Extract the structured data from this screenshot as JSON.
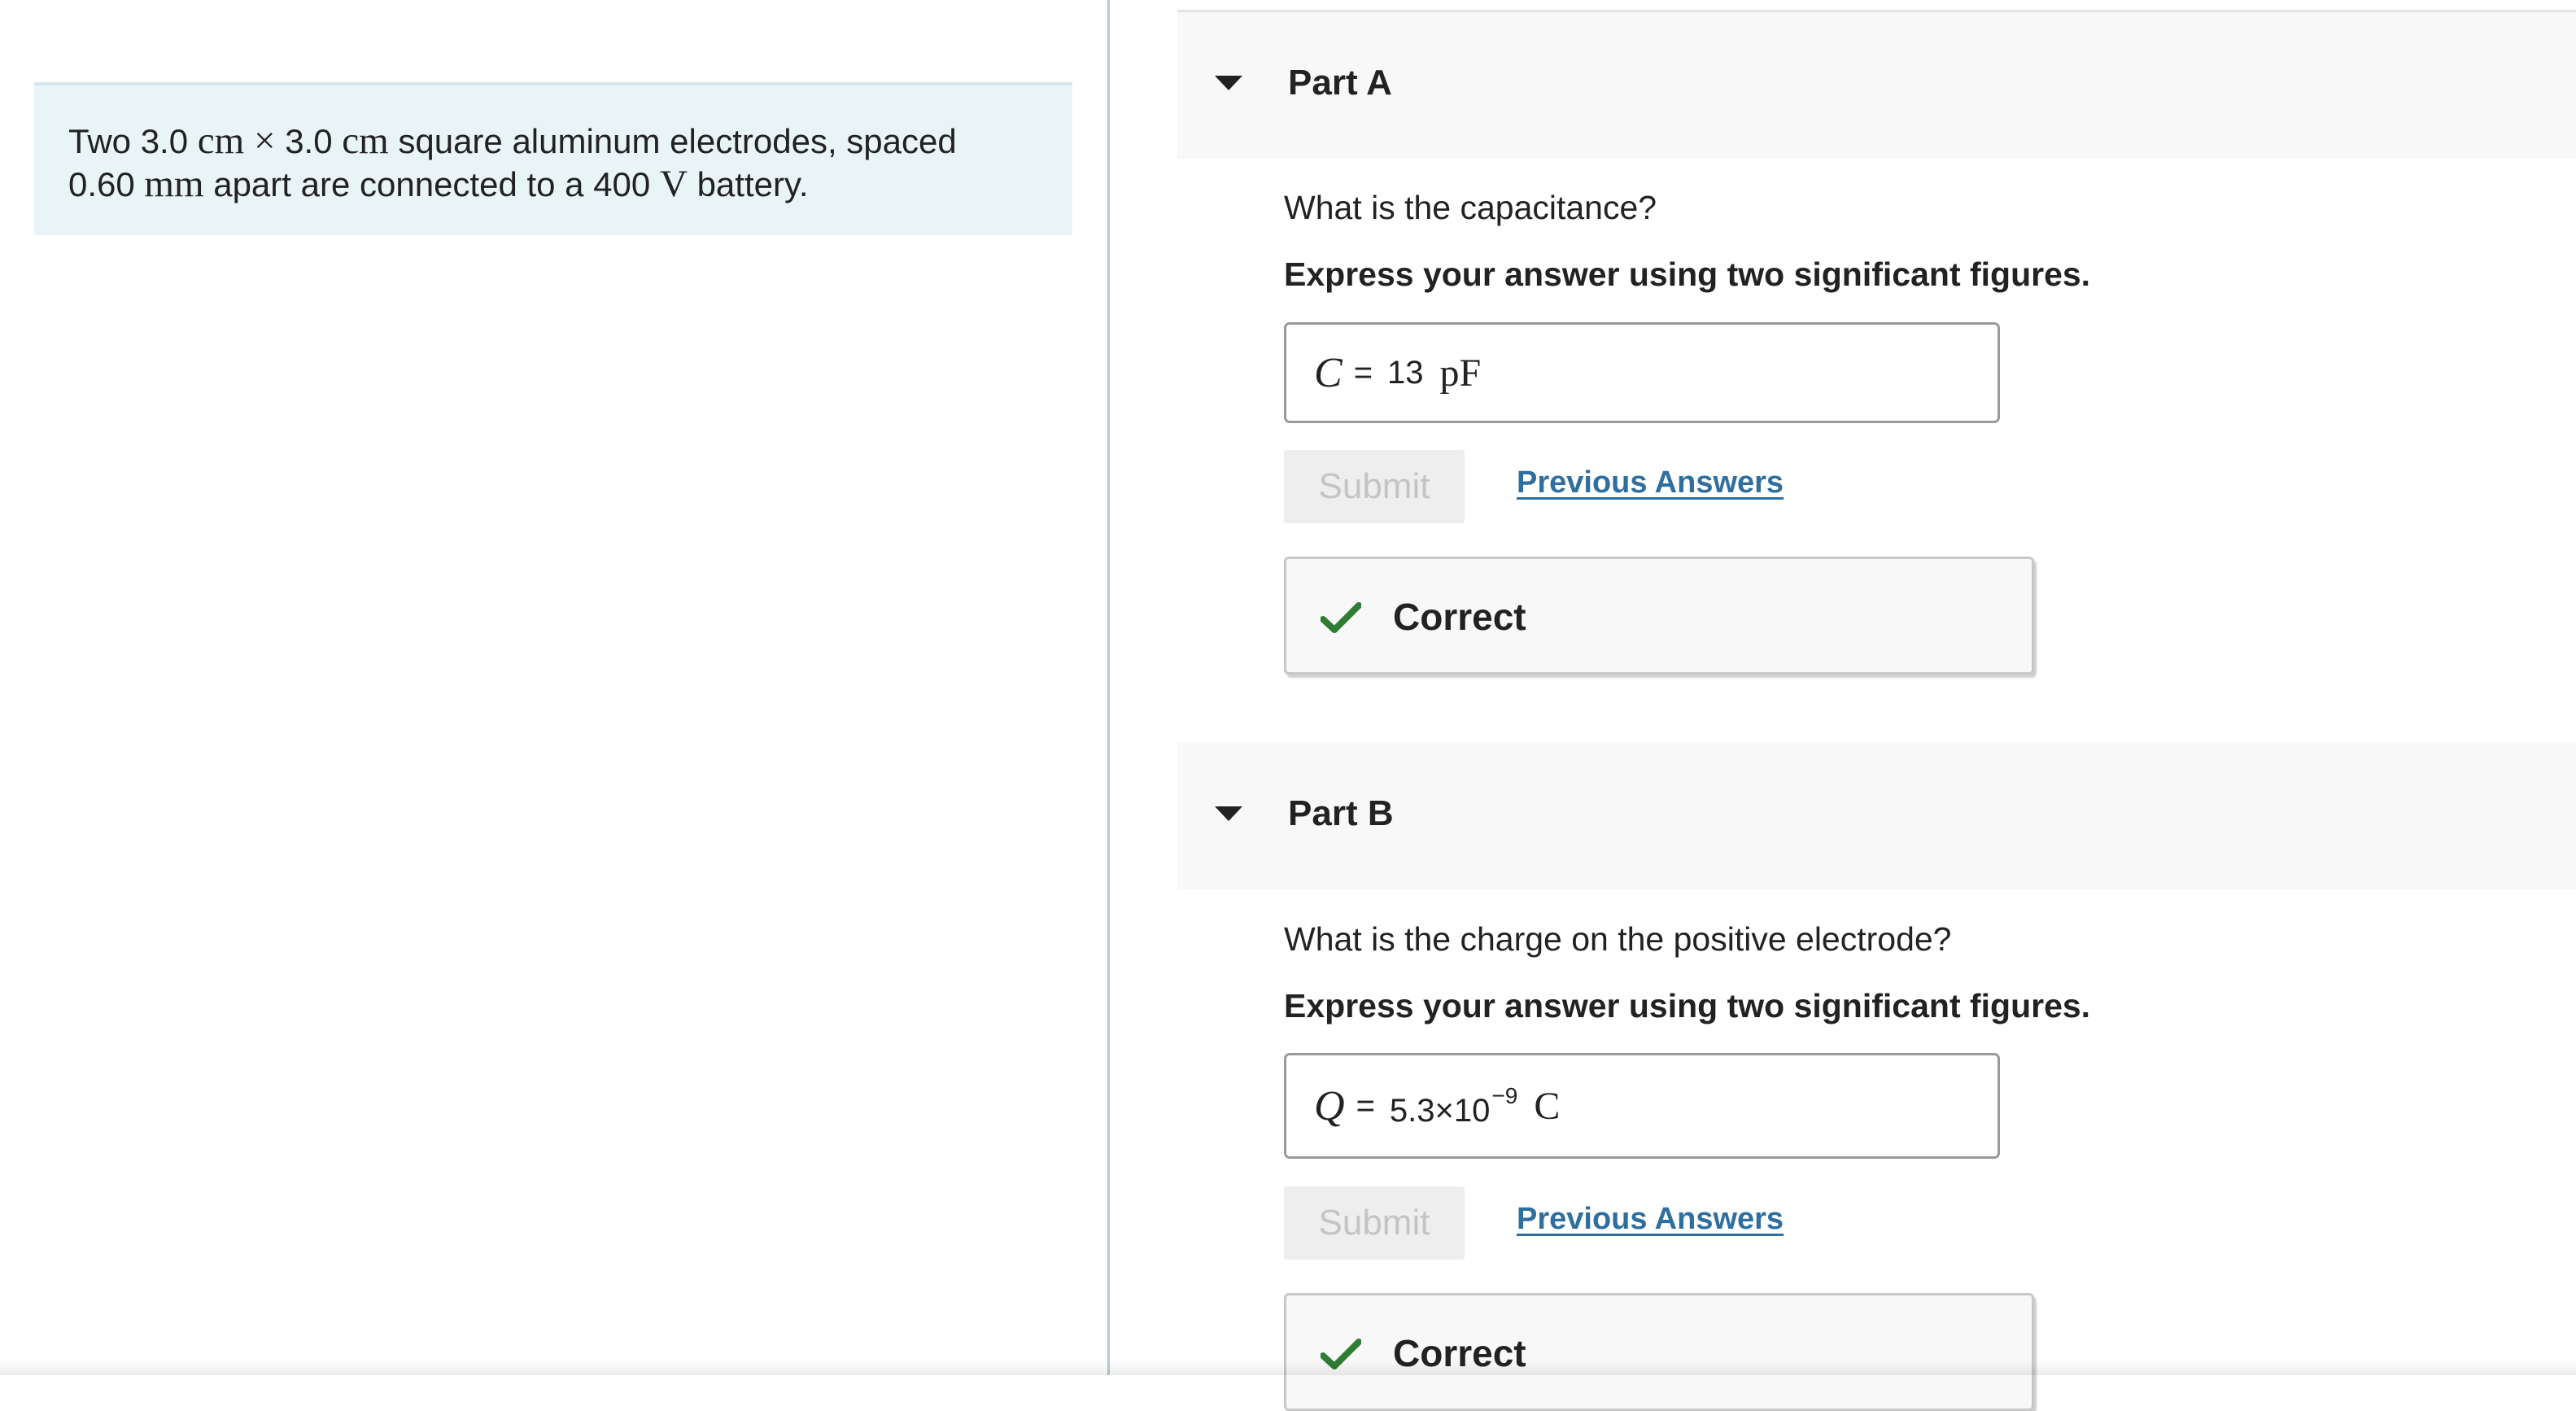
{
  "problem": {
    "segments": [
      "Two 3.0 ",
      "cm",
      " × ",
      "3.0 ",
      "cm",
      " square aluminum electrodes, spaced",
      "0.60 ",
      "mm",
      " apart are connected to a 400 ",
      "V",
      " battery."
    ]
  },
  "parts": [
    {
      "title": "Part A",
      "question": "What is the capacitance?",
      "instruction": "Express your answer using two significant figures.",
      "answer": {
        "variable": "C",
        "equals": "=",
        "value": "13",
        "exponent": "",
        "unit": "pF"
      },
      "submit_label": "Submit",
      "previous_answers_label": "Previous Answers",
      "feedback": "Correct"
    },
    {
      "title": "Part B",
      "question": "What is the charge on the positive electrode?",
      "instruction": "Express your answer using two significant figures.",
      "answer": {
        "variable": "Q",
        "equals": "=",
        "value": "5.3×10",
        "exponent": "−9",
        "unit": "C"
      },
      "submit_label": "Submit",
      "previous_answers_label": "Previous Answers",
      "feedback": "Correct"
    }
  ],
  "icons": {
    "caret": "caret-down-icon",
    "check": "check-icon"
  },
  "colors": {
    "problem_bg": "#e9f4f7",
    "link": "#2f6fa0",
    "check": "#2e7d32",
    "submit_disabled_bg": "#eeeeee"
  }
}
